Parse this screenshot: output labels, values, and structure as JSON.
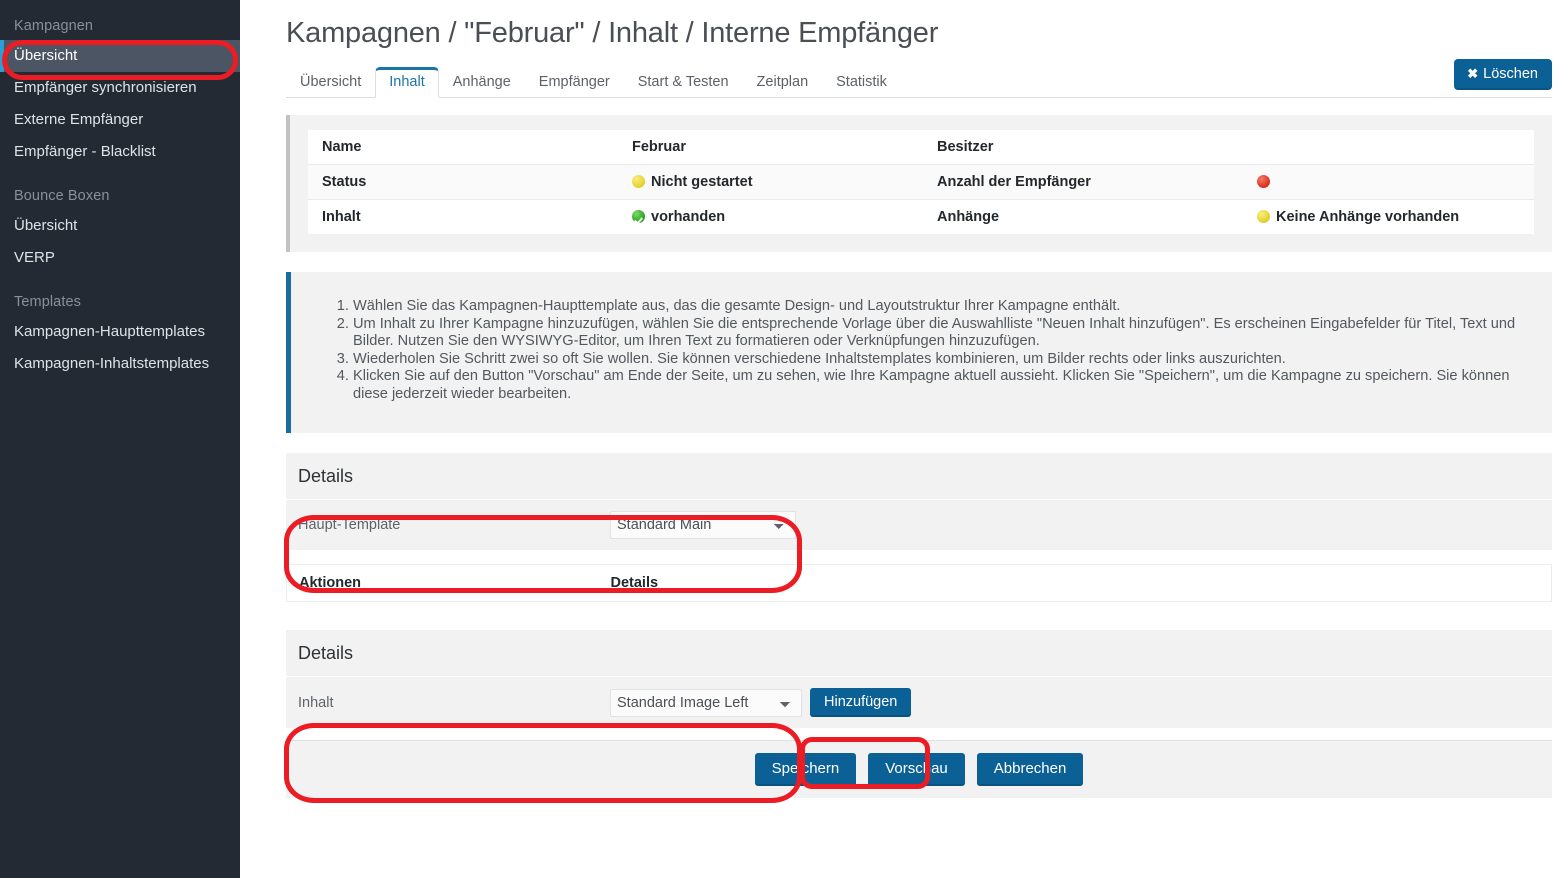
{
  "sidebar": {
    "groups": [
      {
        "title": "Kampagnen",
        "items": [
          {
            "label": "Übersicht",
            "active": true
          },
          {
            "label": "Empfänger synchronisieren",
            "active": false
          },
          {
            "label": "Externe Empfänger",
            "active": false
          },
          {
            "label": "Empfänger - Blacklist",
            "active": false
          }
        ]
      },
      {
        "title": "Bounce Boxen",
        "items": [
          {
            "label": "Übersicht",
            "active": false
          },
          {
            "label": "VERP",
            "active": false
          }
        ]
      },
      {
        "title": "Templates",
        "items": [
          {
            "label": "Kampagnen-Haupttemplates",
            "active": false
          },
          {
            "label": "Kampagnen-Inhaltstemplates",
            "active": false
          }
        ]
      }
    ]
  },
  "header": {
    "title": "Kampagnen / \"Februar\" / Inhalt / Interne Empfänger",
    "delete_button": "Löschen",
    "delete_icon": "close-x-icon"
  },
  "tabs": [
    {
      "label": "Übersicht",
      "active": false
    },
    {
      "label": "Inhalt",
      "active": true
    },
    {
      "label": "Anhänge",
      "active": false
    },
    {
      "label": "Empfänger",
      "active": false
    },
    {
      "label": "Start & Testen",
      "active": false
    },
    {
      "label": "Zeitplan",
      "active": false
    },
    {
      "label": "Statistik",
      "active": false
    }
  ],
  "status_table": {
    "rows": [
      {
        "label_left": "Name",
        "value_left": "Februar",
        "value_left_icon": "",
        "label_right": "Besitzer",
        "value_right": "",
        "value_right_icon": ""
      },
      {
        "label_left": "Status",
        "value_left": "Nicht gestartet",
        "value_left_icon": "yellow-status-dot",
        "label_right": "Anzahl der Empfänger",
        "value_right": "",
        "value_right_icon": "red-status-dot"
      },
      {
        "label_left": "Inhalt",
        "value_left": "vorhanden",
        "value_left_icon": "green-check-dot",
        "label_right": "Anhänge",
        "value_right": "Keine Anhänge vorhanden",
        "value_right_icon": "yellow-status-dot"
      }
    ]
  },
  "instructions": [
    "Wählen Sie das Kampagnen-Haupttemplate aus, das die gesamte Design- und Layoutstruktur Ihrer Kampagne enthält.",
    "Um Inhalt zu Ihrer Kampagne hinzuzufügen, wählen Sie die entsprechende Vorlage über die Auswahlliste \"Neuen Inhalt hinzufügen\". Es erscheinen Eingabefelder für Titel, Text und Bilder. Nutzen Sie den WYSIWYG-Editor, um Ihren Text zu formatieren oder Verknüpfungen hinzuzufügen.",
    "Wiederholen Sie Schritt zwei so oft Sie wollen. Sie können verschiedene Inhaltstemplates kombinieren, um Bilder rechts oder links auszurichten.",
    "Klicken Sie auf den Button \"Vorschau\" am Ende der Seite, um zu sehen, wie Ihre Kampagne aktuell aussieht. Klicken Sie \"Speichern\", um die Kampagne zu speichern. Sie können diese jederzeit wieder bearbeiten."
  ],
  "details_template": {
    "heading": "Details",
    "field_label": "Haupt-Template",
    "select_value": "Standard Main",
    "select_options": [
      "Standard Main"
    ]
  },
  "actions_table": {
    "col_actions": "Aktionen",
    "col_details": "Details"
  },
  "details_content": {
    "heading": "Details",
    "field_label": "Inhalt",
    "select_value": "Standard Image Left",
    "select_options": [
      "Standard Image Left"
    ],
    "add_button": "Hinzufügen"
  },
  "footer": {
    "save": "Speichern",
    "preview": "Vorschau",
    "cancel": "Abbrechen"
  },
  "colors": {
    "accent_blue": "#0b6196",
    "tab_active": "#1b74a8",
    "sidebar_bg": "#242a33",
    "sidebar_active_bg": "#4b5563",
    "sidebar_active_marker": "#2a9fd6",
    "annotation_red": "#ec1c24",
    "panel_bg": "#f2f2f2",
    "info_border": "#1b6e9c",
    "status_yellow": "#e3d02a",
    "status_red": "#dd2c1c",
    "status_green": "#22a218"
  }
}
